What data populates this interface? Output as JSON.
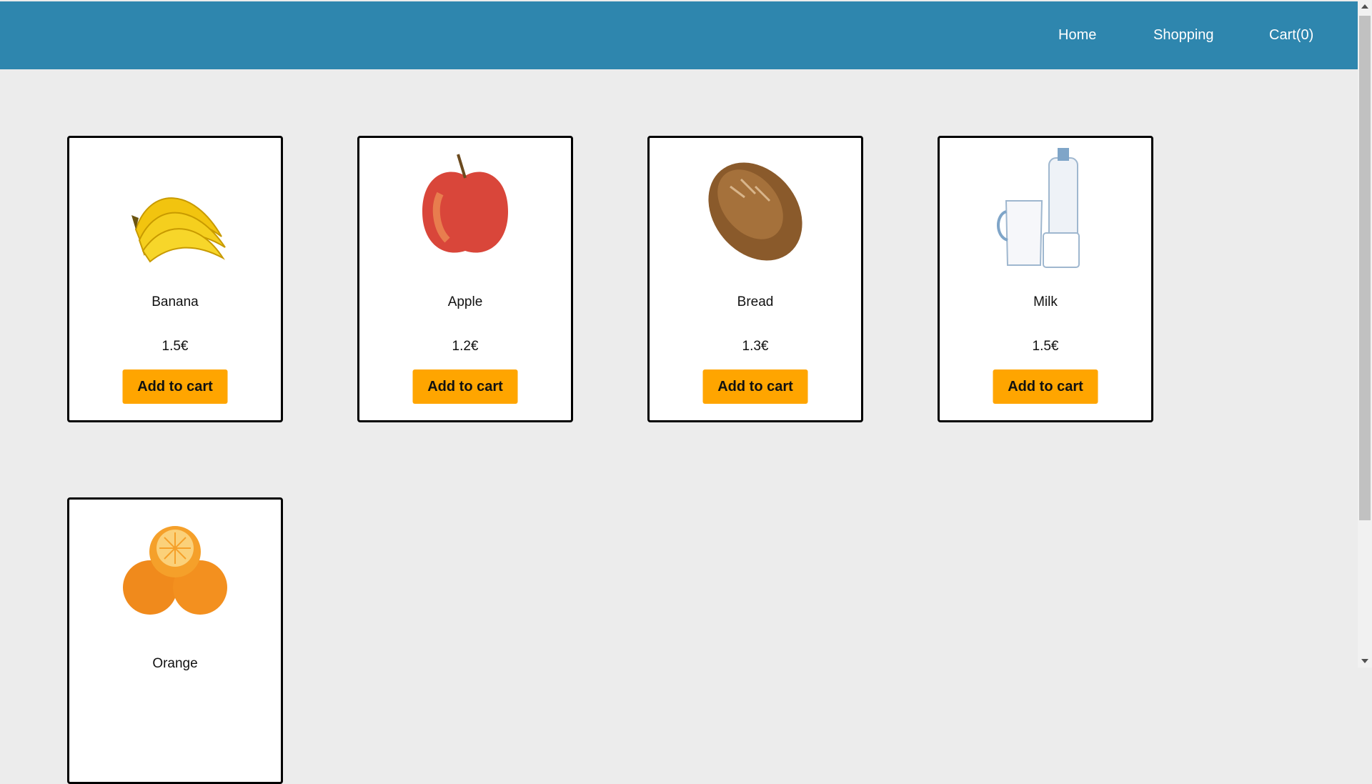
{
  "nav": {
    "home_label": "Home",
    "shopping_label": "Shopping",
    "cart_label": "Cart(0)"
  },
  "colors": {
    "navbar": "#2e86ae",
    "page_background": "#ececec",
    "button": "#ffa500"
  },
  "products": [
    {
      "name": "Banana",
      "price": "1.5€",
      "button_label": "Add to cart",
      "image_icon": "banana-image"
    },
    {
      "name": "Apple",
      "price": "1.2€",
      "button_label": "Add to cart",
      "image_icon": "apple-image"
    },
    {
      "name": "Bread",
      "price": "1.3€",
      "button_label": "Add to cart",
      "image_icon": "bread-image"
    },
    {
      "name": "Milk",
      "price": "1.5€",
      "button_label": "Add to cart",
      "image_icon": "milk-image"
    },
    {
      "name": "Orange",
      "price": "",
      "button_label": "",
      "image_icon": "orange-image"
    }
  ]
}
